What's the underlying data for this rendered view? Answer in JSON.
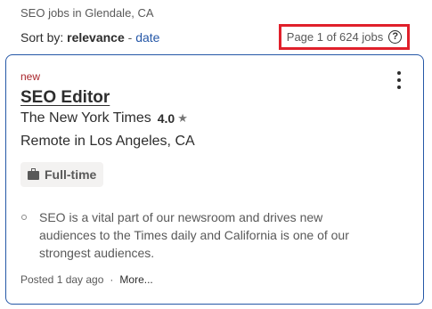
{
  "search": {
    "subtitle": "SEO jobs in Glendale, CA",
    "sort_label": "Sort by:",
    "sort_active": "relevance",
    "sort_separator": "-",
    "sort_alternate": "date",
    "page_count": "Page 1 of 624 jobs",
    "help_icon": "question-circle-icon",
    "highlight_color": "#e0202b"
  },
  "job": {
    "new_tag": "new",
    "title": "SEO Editor",
    "company": "The New York Times",
    "rating": "4.0",
    "rating_icon": "★",
    "location": "Remote in Los Angeles, CA",
    "job_type": "Full-time",
    "job_type_icon": "briefcase-icon",
    "snippet": "SEO is a vital part of our newsroom and drives new audiences to the Times daily and California is one of our strongest audiences.",
    "posted": "Posted 1 day ago",
    "footer_separator": "·",
    "more_label": "More..."
  },
  "colors": {
    "accent": "#2557a7",
    "new_tag": "#a9252b"
  }
}
